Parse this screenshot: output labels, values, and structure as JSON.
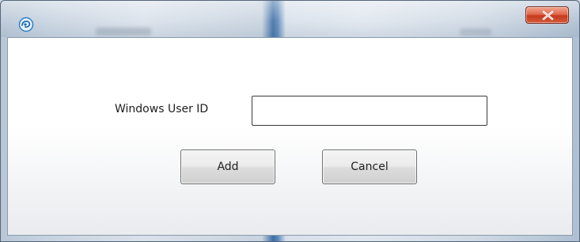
{
  "window": {
    "icon": "app-swirl-icon",
    "close_icon": "close-x-icon",
    "accent_close": "#d24a2b"
  },
  "form": {
    "user_id_label": "Windows User ID",
    "user_id_value": "",
    "user_id_placeholder": ""
  },
  "buttons": {
    "add_label": "Add",
    "cancel_label": "Cancel"
  }
}
